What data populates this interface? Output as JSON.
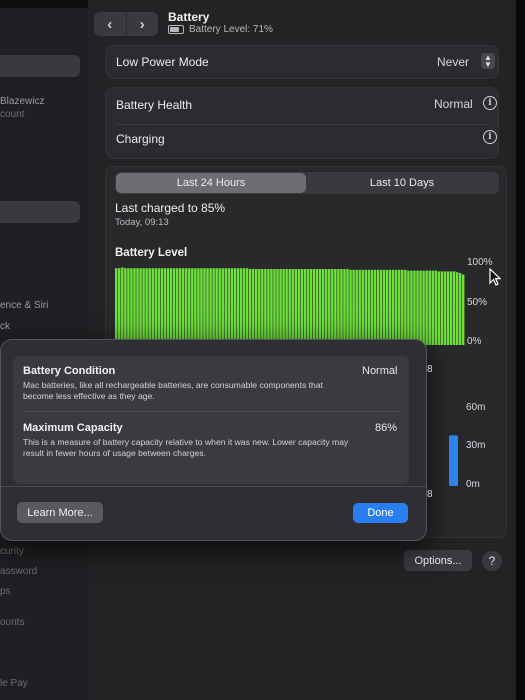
{
  "header": {
    "title": "Battery",
    "subtitle": "Battery Level: 71%"
  },
  "sidebar": {
    "texts": [
      "Blazewicz",
      "count",
      "ence & Siri",
      "ck",
      "curity",
      "assword",
      "ps",
      "ounts",
      "le Pay"
    ]
  },
  "settings": {
    "low_power_label": "Low Power Mode",
    "low_power_value": "Never",
    "health_label": "Battery Health",
    "health_value": "Normal",
    "charging_label": "Charging"
  },
  "usage": {
    "tabs": [
      "Last 24 Hours",
      "Last 10 Days"
    ],
    "last_charged": "Last charged to 85%",
    "last_charged_time": "Today, 09:13",
    "battery_level_title": "Battery Level",
    "level_axis": [
      "100%",
      "50%",
      "0%"
    ],
    "usage_axis": [
      "60m",
      "30m",
      "0m"
    ],
    "peek_hour_label": "8"
  },
  "chart_data": [
    {
      "type": "bar",
      "title": "Battery Level",
      "ylim": [
        0,
        100
      ],
      "ytick_labels": [
        "100%",
        "50%",
        "0%"
      ],
      "values": [
        96,
        96,
        97,
        96,
        96,
        96,
        96,
        96,
        96,
        96,
        96,
        96,
        96,
        96,
        96,
        96,
        96,
        96,
        96,
        96,
        96,
        96,
        96,
        96,
        96,
        96,
        96,
        96,
        96,
        96,
        96,
        96,
        96,
        96,
        96,
        96,
        96,
        96,
        96,
        96,
        96,
        96,
        96,
        96,
        95,
        95,
        95,
        95,
        95,
        95,
        95,
        95,
        95,
        95,
        95,
        95,
        95,
        95,
        95,
        95,
        95,
        95,
        95,
        95,
        95,
        95,
        95,
        95,
        95,
        95,
        95,
        95,
        95,
        95,
        95,
        95,
        95,
        94,
        94,
        94,
        94,
        94,
        94,
        94,
        94,
        94,
        94,
        94,
        94,
        94,
        94,
        94,
        94,
        94,
        94,
        94,
        93,
        93,
        93,
        93,
        93,
        93,
        93,
        93,
        93,
        93,
        92,
        92,
        92,
        92,
        92,
        92,
        91,
        90,
        88
      ]
    },
    {
      "type": "bar",
      "title": "",
      "ylim": [
        0,
        60
      ],
      "ytick_labels": [
        "60m",
        "30m",
        "0m"
      ],
      "values": [
        40
      ]
    }
  ],
  "dialog": {
    "condition_label": "Battery Condition",
    "condition_value": "Normal",
    "condition_desc": "Mac batteries, like all rechargeable batteries, are consumable components that become less effective as they age.",
    "capacity_label": "Maximum Capacity",
    "capacity_value": "86%",
    "capacity_desc": "This is a measure of battery capacity relative to when it was new. Lower capacity may result in fewer hours of usage between charges.",
    "learn_more": "Learn More...",
    "done": "Done"
  },
  "footer": {
    "options": "Options...",
    "help": "?"
  },
  "colors": {
    "bar_green": "#6ee23a",
    "bar_blue": "#2f86f0",
    "accent_button": "#2a7ff0"
  }
}
